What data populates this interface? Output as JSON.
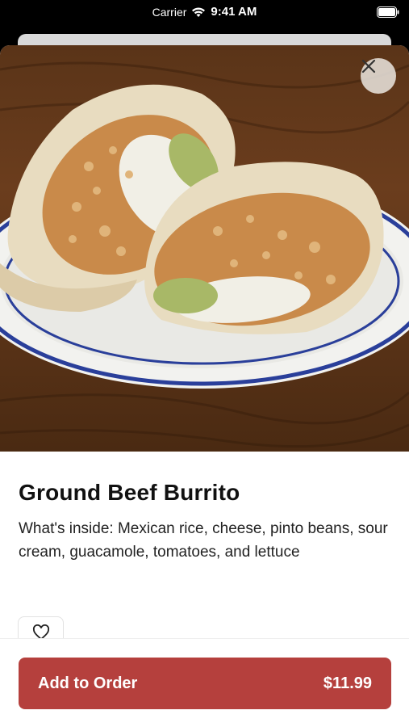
{
  "status_bar": {
    "carrier": "Carrier",
    "time": "9:41 AM"
  },
  "item": {
    "title": "Ground Beef Burrito",
    "description": "What's inside: Mexican rice, cheese, pinto beans, sour cream, guacamole, tomatoes, and lettuce",
    "image_icon": "burrito-photo"
  },
  "actions": {
    "add_label": "Add to Order",
    "price": "$11.99",
    "favorite_icon": "heart-icon",
    "close_icon": "close-icon"
  },
  "colors": {
    "accent": "#b5403d",
    "plate_rim": "#2a3f9a"
  }
}
